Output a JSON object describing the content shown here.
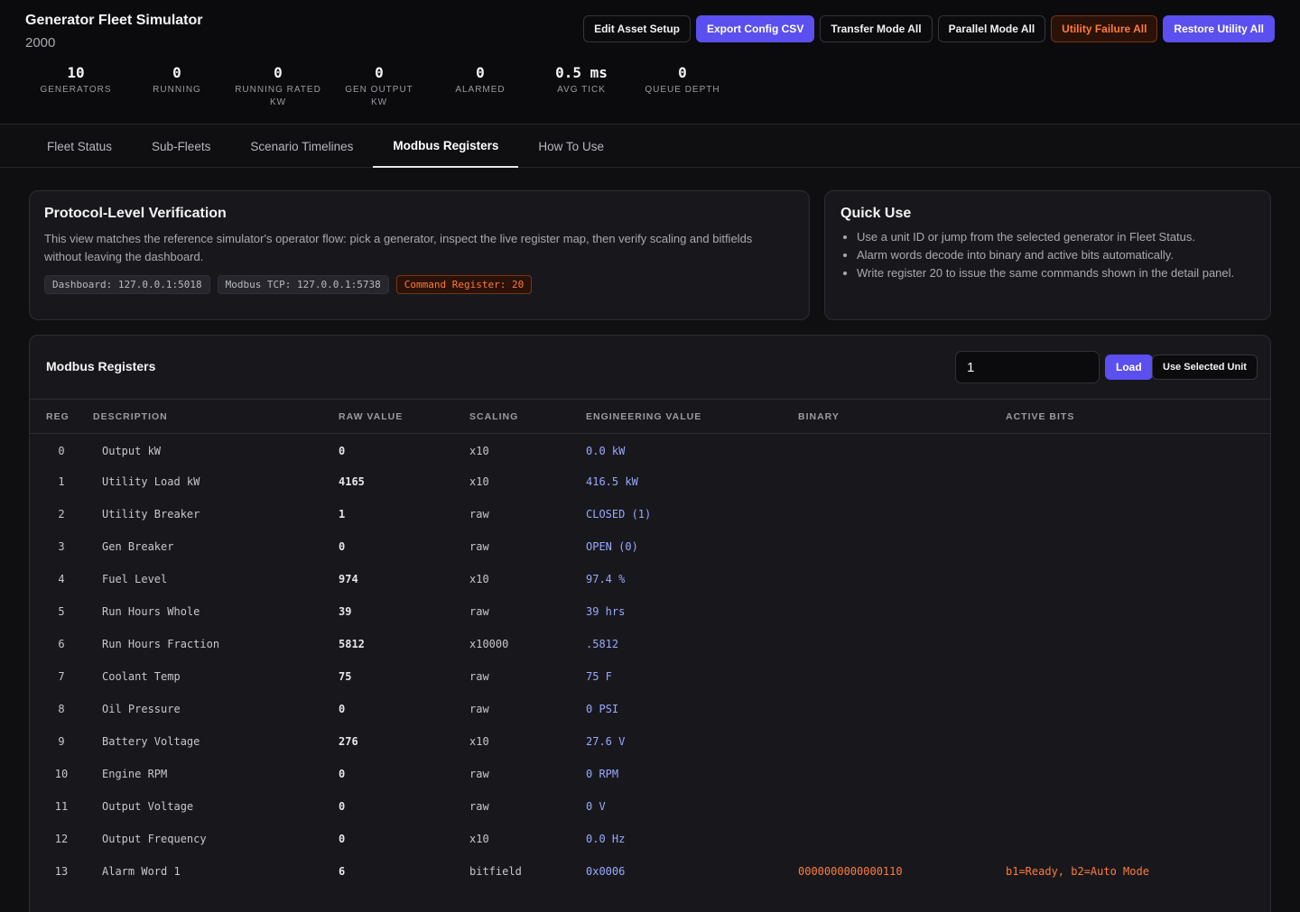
{
  "app": {
    "title": "Generator Fleet Simulator",
    "subtitle": "2000"
  },
  "actions": {
    "edit_asset": "Edit Asset Setup",
    "export_csv": "Export Config CSV",
    "transfer_mode": "Transfer Mode All",
    "parallel_mode": "Parallel Mode All",
    "utility_failure": "Utility Failure All",
    "restore_utility": "Restore Utility All"
  },
  "stats": [
    {
      "value": "10",
      "label": "Generators"
    },
    {
      "value": "0",
      "label": "Running"
    },
    {
      "value": "0",
      "label": "Running Rated kW"
    },
    {
      "value": "0",
      "label": "Gen Output kW"
    },
    {
      "value": "0",
      "label": "Alarmed"
    },
    {
      "value": "0.5 ms",
      "label": "Avg Tick"
    },
    {
      "value": "0",
      "label": "Queue Depth"
    }
  ],
  "tabs": [
    {
      "label": "Fleet Status",
      "active": false
    },
    {
      "label": "Sub-Fleets",
      "active": false
    },
    {
      "label": "Scenario Timelines",
      "active": false
    },
    {
      "label": "Modbus Registers",
      "active": true
    },
    {
      "label": "How To Use",
      "active": false
    }
  ],
  "verification": {
    "title": "Protocol-Level Verification",
    "text": "This view matches the reference simulator's operator flow: pick a generator, inspect the live register map, then verify scaling and bitfields without leaving the dashboard.",
    "chips": {
      "dashboard": "Dashboard: 127.0.0.1:5018",
      "modbus": "Modbus TCP: 127.0.0.1:5738",
      "command": "Command Register: 20"
    }
  },
  "quick_use": {
    "title": "Quick Use",
    "items": [
      "Use a unit ID or jump from the selected generator in Fleet Status.",
      "Alarm words decode into binary and active bits automatically.",
      "Write register 20 to issue the same commands shown in the detail panel."
    ]
  },
  "registers": {
    "title": "Modbus Registers",
    "unit_value": "1",
    "load_label": "Load",
    "use_selected_label": "Use Selected Unit",
    "columns": [
      "Reg",
      "Description",
      "Raw Value",
      "Scaling",
      "Engineering Value",
      "Binary",
      "Active Bits"
    ],
    "rows": [
      {
        "reg": "0",
        "desc": "Output kW",
        "raw": "0",
        "scale": "x10",
        "eng": "0.0 kW",
        "bin": "",
        "bits": ""
      },
      {
        "reg": "1",
        "desc": "Utility Load kW",
        "raw": "4165",
        "scale": "x10",
        "eng": "416.5 kW",
        "bin": "",
        "bits": ""
      },
      {
        "reg": "2",
        "desc": "Utility Breaker",
        "raw": "1",
        "scale": "raw",
        "eng": "CLOSED (1)",
        "bin": "",
        "bits": ""
      },
      {
        "reg": "3",
        "desc": "Gen Breaker",
        "raw": "0",
        "scale": "raw",
        "eng": "OPEN (0)",
        "bin": "",
        "bits": ""
      },
      {
        "reg": "4",
        "desc": "Fuel Level",
        "raw": "974",
        "scale": "x10",
        "eng": "97.4 %",
        "bin": "",
        "bits": ""
      },
      {
        "reg": "5",
        "desc": "Run Hours Whole",
        "raw": "39",
        "scale": "raw",
        "eng": "39 hrs",
        "bin": "",
        "bits": ""
      },
      {
        "reg": "6",
        "desc": "Run Hours Fraction",
        "raw": "5812",
        "scale": "x10000",
        "eng": ".5812",
        "bin": "",
        "bits": ""
      },
      {
        "reg": "7",
        "desc": "Coolant Temp",
        "raw": "75",
        "scale": "raw",
        "eng": "75 F",
        "bin": "",
        "bits": ""
      },
      {
        "reg": "8",
        "desc": "Oil Pressure",
        "raw": "0",
        "scale": "raw",
        "eng": "0 PSI",
        "bin": "",
        "bits": ""
      },
      {
        "reg": "9",
        "desc": "Battery Voltage",
        "raw": "276",
        "scale": "x10",
        "eng": "27.6 V",
        "bin": "",
        "bits": ""
      },
      {
        "reg": "10",
        "desc": "Engine RPM",
        "raw": "0",
        "scale": "raw",
        "eng": "0 RPM",
        "bin": "",
        "bits": ""
      },
      {
        "reg": "11",
        "desc": "Output Voltage",
        "raw": "0",
        "scale": "raw",
        "eng": "0 V",
        "bin": "",
        "bits": ""
      },
      {
        "reg": "12",
        "desc": "Output Frequency",
        "raw": "0",
        "scale": "x10",
        "eng": "0.0 Hz",
        "bin": "",
        "bits": ""
      },
      {
        "reg": "13",
        "desc": "Alarm Word 1",
        "raw": "6",
        "scale": "bitfield",
        "eng": "0x0006",
        "bin": "0000000000000110",
        "bits": "b1=Ready, b2=Auto Mode"
      }
    ]
  }
}
